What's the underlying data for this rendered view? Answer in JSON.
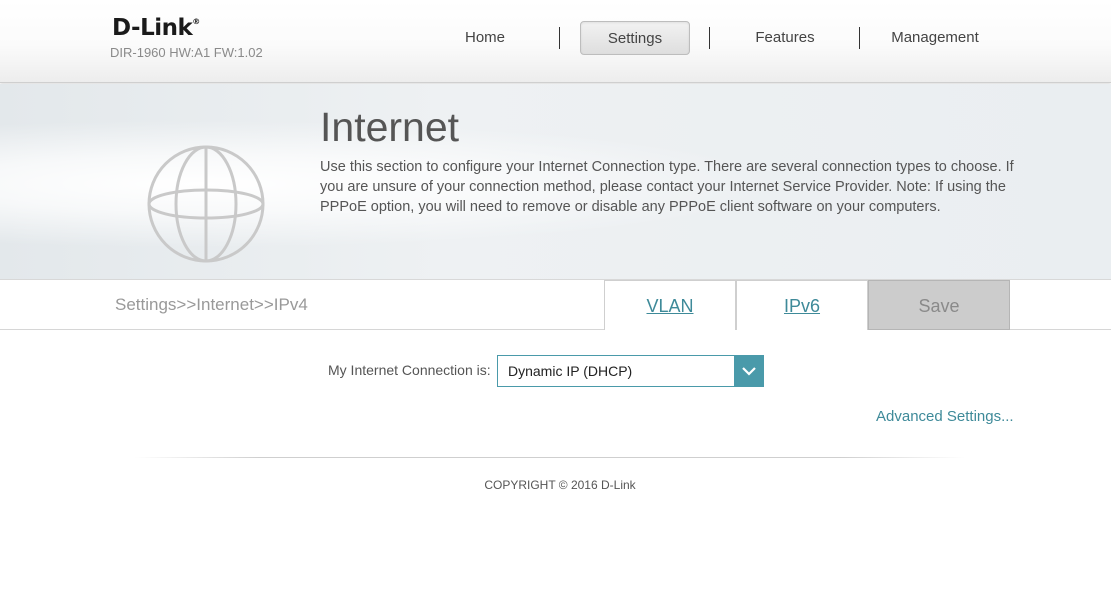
{
  "header": {
    "logo": "D-Link",
    "logo_mark": "®",
    "model_info": "DIR-1960 HW:A1 FW:1.02",
    "nav": [
      {
        "label": "Home",
        "active": false
      },
      {
        "label": "Settings",
        "active": true
      },
      {
        "label": "Features",
        "active": false
      },
      {
        "label": "Management",
        "active": false
      }
    ]
  },
  "banner": {
    "title": "Internet",
    "description": "Use this section to configure your Internet Connection type. There are several connection types to choose. If you are unsure of your connection method, please contact your Internet Service Provider. Note: If using the PPPoE option, you will need to remove or disable any PPPoE client software on your computers.",
    "icon": "globe-icon"
  },
  "tabbar": {
    "breadcrumb": "Settings>>Internet>>IPv4",
    "vlan_label": "VLAN",
    "ipv6_label": "IPv6",
    "save_label": "Save"
  },
  "form": {
    "connection_label": "My Internet Connection is:",
    "connection_value": "Dynamic IP (DHCP)",
    "advanced_link": "Advanced Settings..."
  },
  "footer": {
    "copyright": "COPYRIGHT © 2016 D-Link"
  },
  "colors": {
    "accent": "#4a9aaa",
    "link": "#3e8a99",
    "save_bg": "#cccccc"
  }
}
